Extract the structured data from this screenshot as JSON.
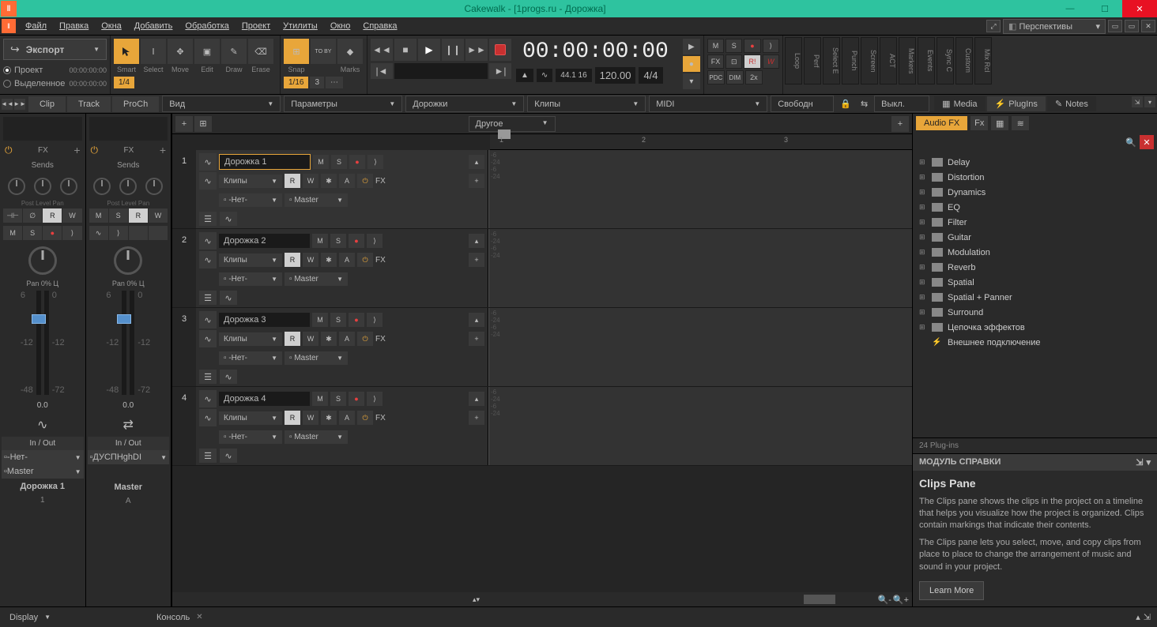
{
  "window": {
    "title": "Cakewalk - [1progs.ru - Дорожка]"
  },
  "menu": {
    "items": [
      "Файл",
      "Правка",
      "Окна",
      "Добавить",
      "Обработка",
      "Проект",
      "Утилиты",
      "Окно",
      "Справка"
    ],
    "perspectives": "Перспективы"
  },
  "export": {
    "label": "Экспорт",
    "radio_project": "Проект",
    "radio_selection": "Выделенное",
    "time1": "00:00:00:00",
    "time2": "00:00:00:00"
  },
  "tools": {
    "labels": [
      "Smart",
      "Select",
      "Move",
      "Edit",
      "Draw",
      "Erase"
    ]
  },
  "snap": {
    "label": "Snap",
    "to_by": "TO BY",
    "marks": "Marks",
    "v1": "1/4",
    "v2": "1/16",
    "v3": "3"
  },
  "transport": {
    "time": "00:00:00:00",
    "meter": "44.1 16",
    "tempo": "120.00",
    "sig": "4/4"
  },
  "mix": {
    "m": "M",
    "s": "S",
    "fx": "FX",
    "pdc": "PDC",
    "dim": "DIM",
    "x2": "2x"
  },
  "vtabs": [
    "Loop",
    "Perf",
    "Select E",
    "Punch",
    "Screen",
    "ACT",
    "Markers",
    "Events",
    "Sync C",
    "Custom",
    "Mix Rcl"
  ],
  "viewbar": {
    "clip": "Clip",
    "track": "Track",
    "proch": "ProCh",
    "drops": [
      "Вид",
      "Параметры",
      "Дорожки",
      "Клипы",
      "MIDI",
      "Свободн",
      "Выкл."
    ]
  },
  "inspector": {
    "ruler_drop": "Другое",
    "ruler_marks": [
      "1",
      "2",
      "3"
    ]
  },
  "channels": {
    "fx": "FX",
    "sends": "Sends",
    "pan": "Pan 0% Ц",
    "val": "0.0",
    "io": "In / Out",
    "knob_labels": "Post Level Pan",
    "ch1": {
      "name": "Дорожка 1",
      "num": "1",
      "sel1": "-Нет-",
      "sel2": "Master"
    },
    "ch2": {
      "name": "Master",
      "num": "A",
      "sel1": "ДУСПHghDI"
    },
    "btns": {
      "m": "M",
      "s": "S",
      "r": "R",
      "w": "W"
    }
  },
  "tracks": [
    {
      "num": "1",
      "name": "Дорожка 1",
      "clips": "Клипы",
      "none": "-Нет-",
      "master": "Master",
      "fx": "FX",
      "selected": true
    },
    {
      "num": "2",
      "name": "Дорожка 2",
      "clips": "Клипы",
      "none": "-Нет-",
      "master": "Master",
      "fx": "FX"
    },
    {
      "num": "3",
      "name": "Дорожка 3",
      "clips": "Клипы",
      "none": "-Нет-",
      "master": "Master",
      "fx": "FX"
    },
    {
      "num": "4",
      "name": "Дорожка 4",
      "clips": "Клипы",
      "none": "-Нет-",
      "master": "Master",
      "fx": "FX"
    }
  ],
  "track_btns": {
    "m": "M",
    "s": "S",
    "r": "R",
    "w": "W",
    "a": "A"
  },
  "browser": {
    "tabs": {
      "media": "Media",
      "plugins": "PlugIns",
      "notes": "Notes"
    },
    "audiofx": "Audio FX",
    "tree": [
      "Delay",
      "Distortion",
      "Dynamics",
      "EQ",
      "Filter",
      "Guitar",
      "Modulation",
      "Reverb",
      "Spatial",
      "Spatial + Panner",
      "Surround",
      "Цепочка эффектов",
      "Внешнее подключение"
    ],
    "count": "24 Plug-ins"
  },
  "help": {
    "header": "МОДУЛЬ СПРАВКИ",
    "title": "Clips Pane",
    "p1": "The Clips pane shows the clips in the project on a timeline that helps you visualize how the project is organized. Clips contain markings that indicate their contents.",
    "p2": "The Clips pane lets you select, move, and copy clips from place to place to change the arrangement of music and sound in your project.",
    "btn": "Learn More"
  },
  "bottom": {
    "display": "Display",
    "console": "Консоль"
  }
}
